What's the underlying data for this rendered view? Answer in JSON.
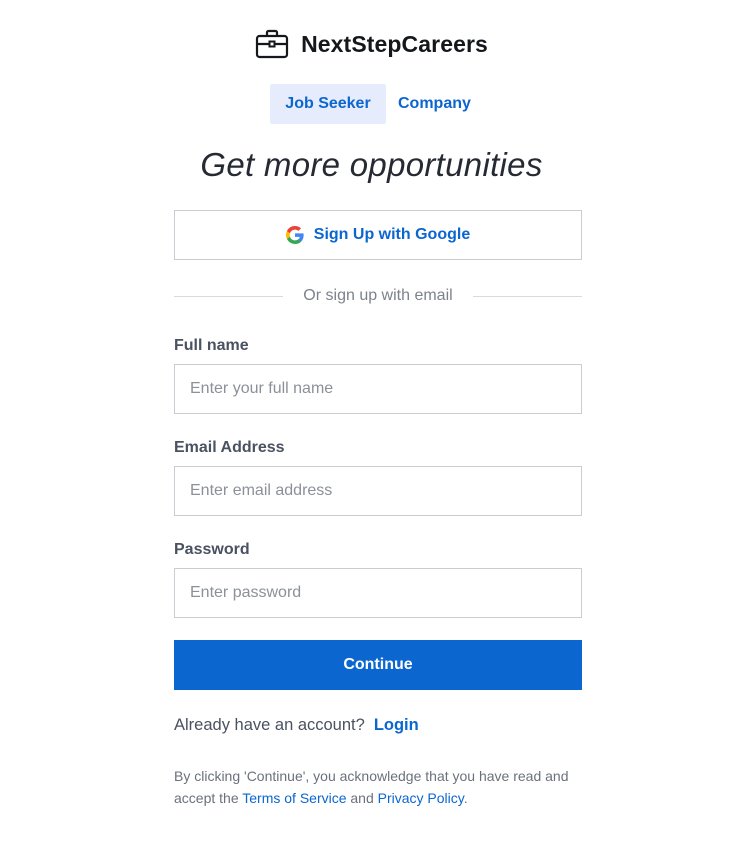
{
  "brand": {
    "name": "NextStepCareers",
    "icon": "briefcase-icon"
  },
  "tabs": [
    {
      "label": "Job Seeker",
      "active": true
    },
    {
      "label": "Company",
      "active": false
    }
  ],
  "headline": "Get more opportunities",
  "google_button": {
    "label": "Sign Up with Google",
    "icon": "google-icon"
  },
  "divider_text": "Or sign up with email",
  "form": {
    "full_name": {
      "label": "Full name",
      "placeholder": "Enter your full name",
      "value": ""
    },
    "email": {
      "label": "Email Address",
      "placeholder": "Enter email address",
      "value": ""
    },
    "password": {
      "label": "Password",
      "placeholder": "Enter password",
      "value": ""
    }
  },
  "continue_label": "Continue",
  "login": {
    "prompt": "Already have an account?",
    "link": "Login"
  },
  "legal": {
    "prefix": "By clicking 'Continue', you acknowledge that you have read and accept the ",
    "terms": "Terms of Service",
    "and": " and ",
    "privacy": "Privacy Policy",
    "suffix": "."
  },
  "colors": {
    "accent": "#0b66d0",
    "active_tab_bg": "#e6ecfb",
    "border": "#c9ccd2"
  }
}
